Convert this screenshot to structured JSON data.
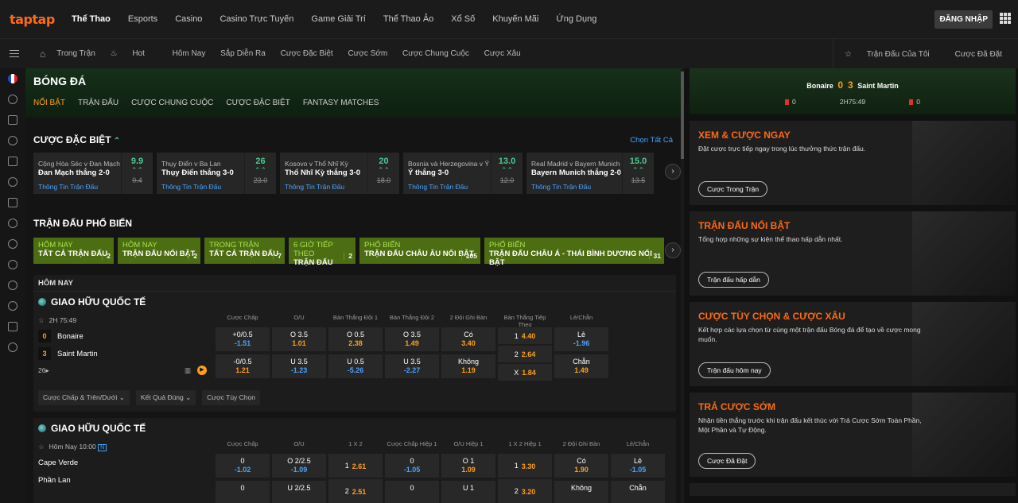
{
  "brand": {
    "logo": "taptap",
    "accent": "#ff6a13",
    "gold": "#ff9f1c",
    "green": "#4ccb8f",
    "blue": "#4aa3ff"
  },
  "topnav": [
    "Thể Thao",
    "Esports",
    "Casino",
    "Casino Trực Tuyến",
    "Game Giải Trí",
    "Thể Thao Ảo",
    "Xổ Số",
    "Khuyến Mãi",
    "Ứng Dụng"
  ],
  "login": "ĐĂNG NHẬP",
  "subnav": [
    "Trong Trận",
    "Hot",
    "Hôm Nay",
    "Sắp Diễn Ra",
    "Cược Đặc Biệt",
    "Cược Sớm",
    "Cược Chung Cuộc",
    "Cược Xâu"
  ],
  "subright": [
    "Trận Đấu Của Tôi",
    "Cược Đã Đặt"
  ],
  "hero": {
    "title": "BÓNG ĐÁ",
    "tabs": [
      "Nổi Bật",
      "Trận Đấu",
      "Cược Chung Cuộc",
      "Cược Đặc Biệt",
      "Fantasy Matches"
    ]
  },
  "special": {
    "title": "Cược Đặc Biệt",
    "choose_all": "Chọn Tất Cả",
    "info": "Thông Tin Trận Đấu",
    "items": [
      {
        "match": "Cộng Hòa Séc v Đan Mạch",
        "sel": "Đan Mạch thắng 2-0",
        "odd": "9.9",
        "old": "9.4"
      },
      {
        "match": "Thụy Điển v Ba Lan",
        "sel": "Thụy Điển thắng 3-0",
        "odd": "26",
        "old": "23.0"
      },
      {
        "match": "Kosovo v Thổ Nhĩ Kỳ",
        "sel": "Thổ Nhĩ Kỳ thắng 3-0",
        "odd": "20",
        "old": "18.0"
      },
      {
        "match": "Bosnia và Herzegovina v Ý",
        "sel": "Ý thắng 3-0",
        "odd": "13.0",
        "old": "12.0"
      },
      {
        "match": "Real Madrid v Bayern Munich",
        "sel": "Bayern Munich thắng 2-0",
        "odd": "15.0",
        "old": "13.5"
      }
    ]
  },
  "popular": {
    "title": "Trận Đấu Phổ Biến",
    "filters": [
      {
        "top": "Hôm Nay",
        "bottom": "Tất Cả Trận Đấu",
        "count": "2"
      },
      {
        "top": "Hôm Nay",
        "bottom": "Trận Đấu Nổi Bật",
        "count": "2"
      },
      {
        "top": "Trong Trận",
        "bottom": "Tất Cả Trận Đấu",
        "count": "7"
      },
      {
        "top": "6 Giờ Tiếp Theo",
        "bottom": "Trận Đấu",
        "count": "2"
      },
      {
        "top": "Phổ Biến",
        "bottom": "Trận Đấu Châu Âu Nổi Bật",
        "count": "105"
      },
      {
        "top": "Phổ Biến",
        "bottom": "Trận Đấu Châu Á - Thái Bình Dương Nổi Bật",
        "count": "31"
      }
    ]
  },
  "today": {
    "label": "HÔM NAY",
    "league": "GIAO HỮU QUỐC TẾ",
    "match1": {
      "time": "2H 75:49",
      "home": "Bonaire",
      "away": "Saint Martin",
      "hs": "0",
      "as": "3",
      "more": "26",
      "cols": [
        {
          "h": "Cược Chấp",
          "c": [
            {
              "l": "+0/0.5",
              "o": "-1.51",
              "t": "dn"
            },
            {
              "l": "-0/0.5",
              "o": "1.21",
              "t": "up"
            }
          ]
        },
        {
          "h": "O/U",
          "c": [
            {
              "l": "O 3.5",
              "o": "1.01",
              "t": "up"
            },
            {
              "l": "U 3.5",
              "o": "-1.23",
              "t": "dn"
            }
          ]
        },
        {
          "h": "Bàn Thắng Đội 1",
          "c": [
            {
              "l": "O 0.5",
              "o": "2.38",
              "t": "up"
            },
            {
              "l": "U 0.5",
              "o": "-5.26",
              "t": "dn"
            }
          ]
        },
        {
          "h": "Bàn Thắng Đội 2",
          "c": [
            {
              "l": "O 3.5",
              "o": "1.49",
              "t": "up"
            },
            {
              "l": "U 3.5",
              "o": "-2.27",
              "t": "dn"
            }
          ]
        },
        {
          "h": "2 Đội Ghi Bàn",
          "c": [
            {
              "l": "Có",
              "o": "3.40",
              "t": "up"
            },
            {
              "l": "Không",
              "o": "1.19",
              "t": "up"
            }
          ]
        },
        {
          "h": "Bàn Thắng Tiếp Theo",
          "c": [
            {
              "l": "1",
              "o": "4.40",
              "t": "up",
              "inl": true
            },
            {
              "l": "2",
              "o": "2.64",
              "t": "up",
              "inl": true
            },
            {
              "l": "X",
              "o": "1.84",
              "t": "up",
              "inl": true
            }
          ]
        },
        {
          "h": "Lẻ/Chẵn",
          "c": [
            {
              "l": "Lẻ",
              "o": "-1.96",
              "t": "dn"
            },
            {
              "l": "Chẵn",
              "o": "1.49",
              "t": "up"
            }
          ]
        }
      ]
    },
    "markets": [
      "Cược Chấp & Trên/Dưới",
      "Kết Quả Đúng",
      "Cược Tùy Chọn"
    ]
  },
  "league2": {
    "name": "GIAO HỮU QUỐC TẾ",
    "time": "Hôm Nay 10:00",
    "home": "Cape Verde",
    "away": "Phần Lan",
    "cols": [
      {
        "h": "Cược Chấp",
        "c": [
          {
            "l": "0",
            "o": "-1.02",
            "t": "dn"
          },
          {
            "l": "0",
            "o": "",
            "t": "up"
          }
        ]
      },
      {
        "h": "O/U",
        "c": [
          {
            "l": "O 2/2.5",
            "o": "-1.09",
            "t": "dn"
          },
          {
            "l": "U 2/2.5",
            "o": "",
            "t": "up"
          }
        ]
      },
      {
        "h": "1 X 2",
        "c": [
          {
            "l": "1",
            "o": "2.61",
            "t": "up",
            "inl": true
          },
          {
            "l": "2",
            "o": "2.51",
            "t": "up",
            "inl": true
          }
        ]
      },
      {
        "h": "Cược Chấp Hiệp 1",
        "c": [
          {
            "l": "0",
            "o": "-1.05",
            "t": "dn"
          },
          {
            "l": "0",
            "o": "",
            "t": "up"
          }
        ]
      },
      {
        "h": "O/U Hiệp 1",
        "c": [
          {
            "l": "O 1",
            "o": "1.09",
            "t": "up"
          },
          {
            "l": "U 1",
            "o": "",
            "t": "up"
          }
        ]
      },
      {
        "h": "1 X 2 Hiệp 1",
        "c": [
          {
            "l": "1",
            "o": "3.30",
            "t": "up",
            "inl": true
          },
          {
            "l": "2",
            "o": "3.20",
            "t": "up",
            "inl": true
          }
        ]
      },
      {
        "h": "2 Đội Ghi Bàn",
        "c": [
          {
            "l": "Có",
            "o": "1.90",
            "t": "up"
          },
          {
            "l": "Không",
            "o": "",
            "t": "up"
          }
        ]
      },
      {
        "h": "Lẻ/Chẵn",
        "c": [
          {
            "l": "Lẻ",
            "o": "-1.05",
            "t": "dn"
          },
          {
            "l": "Chẵn",
            "o": "",
            "t": "up"
          }
        ]
      }
    ]
  },
  "scorebar": {
    "home": "Bonaire",
    "hs": "0",
    "as": "3",
    "away": "Saint Martin",
    "time": "2H75:49",
    "hc": "0",
    "ac": "0"
  },
  "promos": [
    {
      "title": "Xem & Cược Ngay",
      "desc": "Đặt cược trực tiếp ngay trong lúc thưởng thức trận đấu.",
      "btn": "Cược Trong Trận"
    },
    {
      "title": "Trận Đấu Nổi Bật",
      "desc": "Tổng hợp những sự kiện thể thao hấp dẫn nhất.",
      "btn": "Trận đấu hấp dẫn"
    },
    {
      "title": "Cược Tùy Chọn & Cược Xâu",
      "desc": "Kết hợp các lựa chọn từ cùng một trận đấu Bóng đá để tạo về cược mong muốn.",
      "btn": "Trận đấu hôm nay"
    },
    {
      "title": "Trả Cược Sớm",
      "desc": "Nhận tiền thắng trước khi trận đấu kết thúc với Trả Cược Sớm Toàn Phần, Một Phần và Tự Động.",
      "btn": "Cược Đã Đặt"
    }
  ]
}
